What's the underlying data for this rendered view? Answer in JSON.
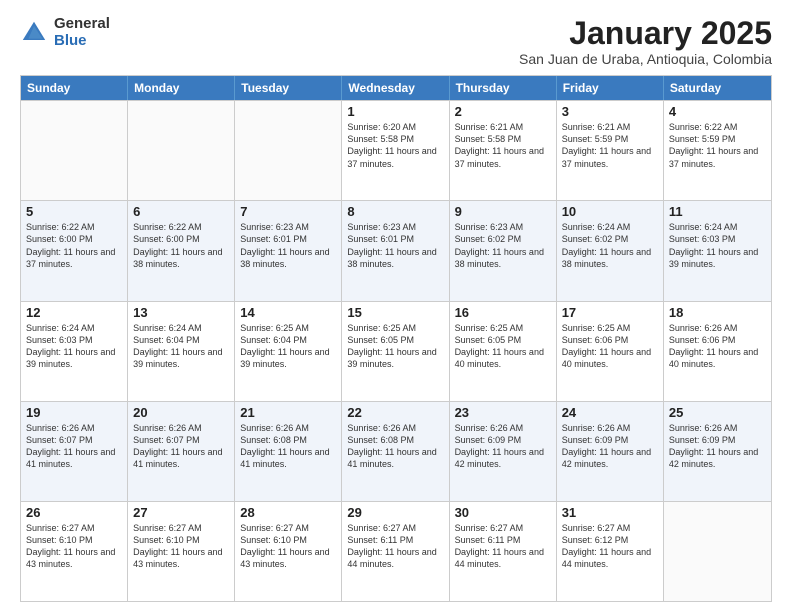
{
  "logo": {
    "general": "General",
    "blue": "Blue"
  },
  "title": "January 2025",
  "subtitle": "San Juan de Uraba, Antioquia, Colombia",
  "days_of_week": [
    "Sunday",
    "Monday",
    "Tuesday",
    "Wednesday",
    "Thursday",
    "Friday",
    "Saturday"
  ],
  "weeks": [
    [
      {
        "day": "",
        "sunrise": "",
        "sunset": "",
        "daylight": ""
      },
      {
        "day": "",
        "sunrise": "",
        "sunset": "",
        "daylight": ""
      },
      {
        "day": "",
        "sunrise": "",
        "sunset": "",
        "daylight": ""
      },
      {
        "day": "1",
        "sunrise": "Sunrise: 6:20 AM",
        "sunset": "Sunset: 5:58 PM",
        "daylight": "Daylight: 11 hours and 37 minutes."
      },
      {
        "day": "2",
        "sunrise": "Sunrise: 6:21 AM",
        "sunset": "Sunset: 5:58 PM",
        "daylight": "Daylight: 11 hours and 37 minutes."
      },
      {
        "day": "3",
        "sunrise": "Sunrise: 6:21 AM",
        "sunset": "Sunset: 5:59 PM",
        "daylight": "Daylight: 11 hours and 37 minutes."
      },
      {
        "day": "4",
        "sunrise": "Sunrise: 6:22 AM",
        "sunset": "Sunset: 5:59 PM",
        "daylight": "Daylight: 11 hours and 37 minutes."
      }
    ],
    [
      {
        "day": "5",
        "sunrise": "Sunrise: 6:22 AM",
        "sunset": "Sunset: 6:00 PM",
        "daylight": "Daylight: 11 hours and 37 minutes."
      },
      {
        "day": "6",
        "sunrise": "Sunrise: 6:22 AM",
        "sunset": "Sunset: 6:00 PM",
        "daylight": "Daylight: 11 hours and 38 minutes."
      },
      {
        "day": "7",
        "sunrise": "Sunrise: 6:23 AM",
        "sunset": "Sunset: 6:01 PM",
        "daylight": "Daylight: 11 hours and 38 minutes."
      },
      {
        "day": "8",
        "sunrise": "Sunrise: 6:23 AM",
        "sunset": "Sunset: 6:01 PM",
        "daylight": "Daylight: 11 hours and 38 minutes."
      },
      {
        "day": "9",
        "sunrise": "Sunrise: 6:23 AM",
        "sunset": "Sunset: 6:02 PM",
        "daylight": "Daylight: 11 hours and 38 minutes."
      },
      {
        "day": "10",
        "sunrise": "Sunrise: 6:24 AM",
        "sunset": "Sunset: 6:02 PM",
        "daylight": "Daylight: 11 hours and 38 minutes."
      },
      {
        "day": "11",
        "sunrise": "Sunrise: 6:24 AM",
        "sunset": "Sunset: 6:03 PM",
        "daylight": "Daylight: 11 hours and 39 minutes."
      }
    ],
    [
      {
        "day": "12",
        "sunrise": "Sunrise: 6:24 AM",
        "sunset": "Sunset: 6:03 PM",
        "daylight": "Daylight: 11 hours and 39 minutes."
      },
      {
        "day": "13",
        "sunrise": "Sunrise: 6:24 AM",
        "sunset": "Sunset: 6:04 PM",
        "daylight": "Daylight: 11 hours and 39 minutes."
      },
      {
        "day": "14",
        "sunrise": "Sunrise: 6:25 AM",
        "sunset": "Sunset: 6:04 PM",
        "daylight": "Daylight: 11 hours and 39 minutes."
      },
      {
        "day": "15",
        "sunrise": "Sunrise: 6:25 AM",
        "sunset": "Sunset: 6:05 PM",
        "daylight": "Daylight: 11 hours and 39 minutes."
      },
      {
        "day": "16",
        "sunrise": "Sunrise: 6:25 AM",
        "sunset": "Sunset: 6:05 PM",
        "daylight": "Daylight: 11 hours and 40 minutes."
      },
      {
        "day": "17",
        "sunrise": "Sunrise: 6:25 AM",
        "sunset": "Sunset: 6:06 PM",
        "daylight": "Daylight: 11 hours and 40 minutes."
      },
      {
        "day": "18",
        "sunrise": "Sunrise: 6:26 AM",
        "sunset": "Sunset: 6:06 PM",
        "daylight": "Daylight: 11 hours and 40 minutes."
      }
    ],
    [
      {
        "day": "19",
        "sunrise": "Sunrise: 6:26 AM",
        "sunset": "Sunset: 6:07 PM",
        "daylight": "Daylight: 11 hours and 41 minutes."
      },
      {
        "day": "20",
        "sunrise": "Sunrise: 6:26 AM",
        "sunset": "Sunset: 6:07 PM",
        "daylight": "Daylight: 11 hours and 41 minutes."
      },
      {
        "day": "21",
        "sunrise": "Sunrise: 6:26 AM",
        "sunset": "Sunset: 6:08 PM",
        "daylight": "Daylight: 11 hours and 41 minutes."
      },
      {
        "day": "22",
        "sunrise": "Sunrise: 6:26 AM",
        "sunset": "Sunset: 6:08 PM",
        "daylight": "Daylight: 11 hours and 41 minutes."
      },
      {
        "day": "23",
        "sunrise": "Sunrise: 6:26 AM",
        "sunset": "Sunset: 6:09 PM",
        "daylight": "Daylight: 11 hours and 42 minutes."
      },
      {
        "day": "24",
        "sunrise": "Sunrise: 6:26 AM",
        "sunset": "Sunset: 6:09 PM",
        "daylight": "Daylight: 11 hours and 42 minutes."
      },
      {
        "day": "25",
        "sunrise": "Sunrise: 6:26 AM",
        "sunset": "Sunset: 6:09 PM",
        "daylight": "Daylight: 11 hours and 42 minutes."
      }
    ],
    [
      {
        "day": "26",
        "sunrise": "Sunrise: 6:27 AM",
        "sunset": "Sunset: 6:10 PM",
        "daylight": "Daylight: 11 hours and 43 minutes."
      },
      {
        "day": "27",
        "sunrise": "Sunrise: 6:27 AM",
        "sunset": "Sunset: 6:10 PM",
        "daylight": "Daylight: 11 hours and 43 minutes."
      },
      {
        "day": "28",
        "sunrise": "Sunrise: 6:27 AM",
        "sunset": "Sunset: 6:10 PM",
        "daylight": "Daylight: 11 hours and 43 minutes."
      },
      {
        "day": "29",
        "sunrise": "Sunrise: 6:27 AM",
        "sunset": "Sunset: 6:11 PM",
        "daylight": "Daylight: 11 hours and 44 minutes."
      },
      {
        "day": "30",
        "sunrise": "Sunrise: 6:27 AM",
        "sunset": "Sunset: 6:11 PM",
        "daylight": "Daylight: 11 hours and 44 minutes."
      },
      {
        "day": "31",
        "sunrise": "Sunrise: 6:27 AM",
        "sunset": "Sunset: 6:12 PM",
        "daylight": "Daylight: 11 hours and 44 minutes."
      },
      {
        "day": "",
        "sunrise": "",
        "sunset": "",
        "daylight": ""
      }
    ]
  ]
}
